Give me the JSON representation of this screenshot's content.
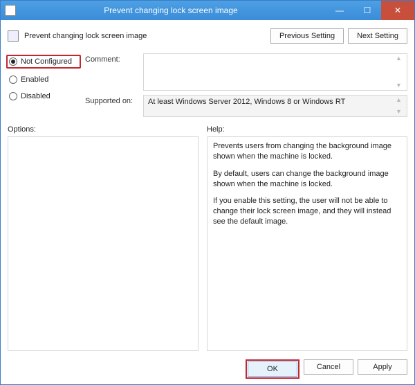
{
  "titlebar": {
    "title": "Prevent changing lock screen image"
  },
  "header": {
    "title": "Prevent changing lock screen image"
  },
  "nav": {
    "prev": "Previous Setting",
    "next": "Next Setting"
  },
  "radios": {
    "not_configured": "Not Configured",
    "enabled": "Enabled",
    "disabled": "Disabled"
  },
  "labels": {
    "comment": "Comment:",
    "supported": "Supported on:",
    "options": "Options:",
    "help": "Help:"
  },
  "supported_text": "At least Windows Server 2012, Windows 8 or Windows RT",
  "help": {
    "p1": "Prevents users from changing the background image shown when the machine is locked.",
    "p2": "By default, users can change the background image shown when the machine is locked.",
    "p3": "If you enable this setting, the user will not be able to change their lock screen image, and they will instead see the default image."
  },
  "footer": {
    "ok": "OK",
    "cancel": "Cancel",
    "apply": "Apply"
  }
}
